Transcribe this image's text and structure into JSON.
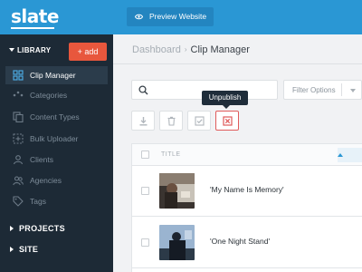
{
  "app": {
    "logo": "slate"
  },
  "topbar": {
    "preview_label": "Preview Website"
  },
  "sidebar": {
    "library_title": "LIBRARY",
    "add_label": "+ add",
    "items": [
      {
        "label": "Clip Manager",
        "icon": "clip-grid-icon",
        "active": true
      },
      {
        "label": "Categories",
        "icon": "categories-icon",
        "active": false
      },
      {
        "label": "Content Types",
        "icon": "content-types-icon",
        "active": false
      },
      {
        "label": "Bulk Uploader",
        "icon": "bulk-upload-icon",
        "active": false
      },
      {
        "label": "Clients",
        "icon": "user-icon",
        "active": false
      },
      {
        "label": "Agencies",
        "icon": "users-icon",
        "active": false
      },
      {
        "label": "Tags",
        "icon": "tag-icon",
        "active": false
      }
    ],
    "sections": [
      {
        "label": "PROJECTS"
      },
      {
        "label": "SITE"
      }
    ]
  },
  "breadcrumb": {
    "parent": "Dashboard",
    "separator": "›",
    "current": "Clip Manager"
  },
  "toolbar": {
    "search_placeholder": "",
    "filter_label": "Filter Options",
    "tooltip": "Unpublish",
    "actions": [
      "download-icon",
      "trash-icon",
      "publish-check-icon",
      "unpublish-x-icon"
    ]
  },
  "table": {
    "header_title": "TITLE",
    "rows": [
      {
        "title": "'My Name Is Memory'"
      },
      {
        "title": "'One Night Stand'"
      }
    ]
  },
  "colors": {
    "brand_blue": "#2a97d4",
    "sidebar_bg": "#1d2a36",
    "add_button": "#e8573d",
    "danger": "#e05b5b"
  }
}
